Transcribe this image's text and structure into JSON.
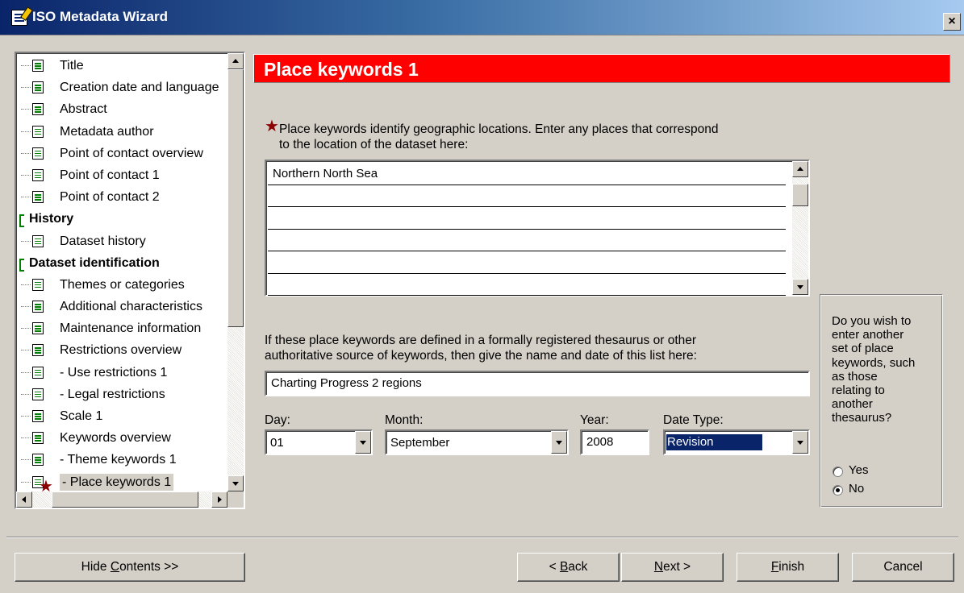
{
  "window": {
    "title": "ISO Metadata Wizard",
    "close_glyph": "×"
  },
  "tree": {
    "items": [
      {
        "label": "Title",
        "kind": "child"
      },
      {
        "label": "Creation date and language",
        "kind": "child"
      },
      {
        "label": "Abstract",
        "kind": "child"
      },
      {
        "label": "Metadata author",
        "kind": "child"
      },
      {
        "label": "Point of contact overview",
        "kind": "child"
      },
      {
        "label": "Point of contact 1",
        "kind": "child"
      },
      {
        "label": "Point of contact 2",
        "kind": "child"
      },
      {
        "label": "History",
        "kind": "group"
      },
      {
        "label": "Dataset history",
        "kind": "child"
      },
      {
        "label": "Dataset identification",
        "kind": "group"
      },
      {
        "label": "Themes or categories",
        "kind": "child"
      },
      {
        "label": "Additional characteristics",
        "kind": "child"
      },
      {
        "label": "Maintenance information",
        "kind": "child"
      },
      {
        "label": "Restrictions overview",
        "kind": "child"
      },
      {
        "label": "- Use restrictions 1",
        "kind": "child"
      },
      {
        "label": "- Legal restrictions",
        "kind": "child"
      },
      {
        "label": "Scale 1",
        "kind": "child"
      },
      {
        "label": "Keywords overview",
        "kind": "child"
      },
      {
        "label": "- Theme keywords 1",
        "kind": "child"
      },
      {
        "label": "- Place keywords 1",
        "kind": "child",
        "selected": true
      }
    ],
    "required_star": "★"
  },
  "page": {
    "title": "Place keywords 1",
    "header_color": "#ff0000",
    "required_star": "★",
    "intro_line1": "Place keywords identify geographic locations.  Enter any places that correspond",
    "intro_line2": "to the location of the dataset here:",
    "keywords": [
      "Northern North Sea",
      "",
      "",
      "",
      "",
      ""
    ],
    "thesaurus_line1": "If these place keywords are defined in a formally registered thesaurus or other",
    "thesaurus_line2": "authoritative source of keywords, then give the name and date of this list here:",
    "thesaurus_name": "Charting Progress 2 regions",
    "day_label": "Day:",
    "day_value": "01",
    "month_label": "Month:",
    "month_value": "September",
    "year_label": "Year:",
    "year_value": "2008",
    "date_type_label": "Date Type:",
    "date_type_value": "Revision"
  },
  "side_question": {
    "lines": [
      "Do you wish to",
      "enter another",
      "set of place",
      "keywords, such",
      "as those",
      "relating to",
      "another",
      "thesaurus?"
    ],
    "yes_label": "Yes",
    "no_label": "No",
    "selected": "No"
  },
  "buttons": {
    "hide_contents": {
      "pre": "Hide ",
      "u": "C",
      "post": "ontents >>"
    },
    "back": {
      "pre": "< ",
      "u": "B",
      "post": "ack"
    },
    "next": {
      "pre": "",
      "u": "N",
      "post": "ext >"
    },
    "finish": {
      "pre": "",
      "u": "F",
      "post": "inish"
    },
    "cancel": {
      "pre": "Cancel",
      "u": "",
      "post": ""
    }
  }
}
